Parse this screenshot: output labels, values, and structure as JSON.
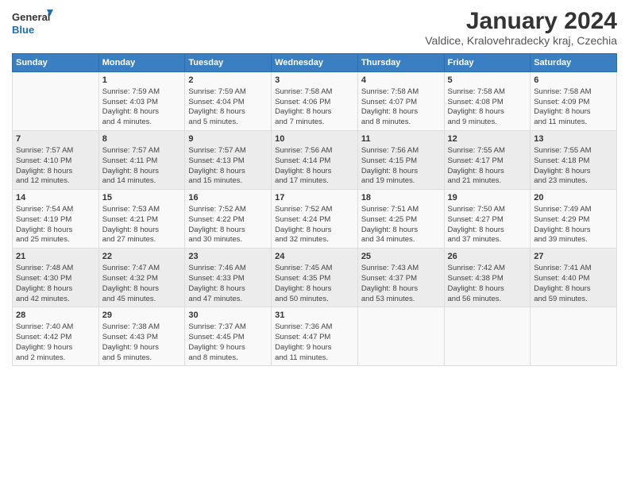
{
  "logo": {
    "line1": "General",
    "line2": "Blue"
  },
  "title": "January 2024",
  "subtitle": "Valdice, Kralovehradecky kraj, Czechia",
  "headers": [
    "Sunday",
    "Monday",
    "Tuesday",
    "Wednesday",
    "Thursday",
    "Friday",
    "Saturday"
  ],
  "weeks": [
    [
      {
        "day": "",
        "info": ""
      },
      {
        "day": "1",
        "info": "Sunrise: 7:59 AM\nSunset: 4:03 PM\nDaylight: 8 hours\nand 4 minutes."
      },
      {
        "day": "2",
        "info": "Sunrise: 7:59 AM\nSunset: 4:04 PM\nDaylight: 8 hours\nand 5 minutes."
      },
      {
        "day": "3",
        "info": "Sunrise: 7:58 AM\nSunset: 4:06 PM\nDaylight: 8 hours\nand 7 minutes."
      },
      {
        "day": "4",
        "info": "Sunrise: 7:58 AM\nSunset: 4:07 PM\nDaylight: 8 hours\nand 8 minutes."
      },
      {
        "day": "5",
        "info": "Sunrise: 7:58 AM\nSunset: 4:08 PM\nDaylight: 8 hours\nand 9 minutes."
      },
      {
        "day": "6",
        "info": "Sunrise: 7:58 AM\nSunset: 4:09 PM\nDaylight: 8 hours\nand 11 minutes."
      }
    ],
    [
      {
        "day": "7",
        "info": "Sunrise: 7:57 AM\nSunset: 4:10 PM\nDaylight: 8 hours\nand 12 minutes."
      },
      {
        "day": "8",
        "info": "Sunrise: 7:57 AM\nSunset: 4:11 PM\nDaylight: 8 hours\nand 14 minutes."
      },
      {
        "day": "9",
        "info": "Sunrise: 7:57 AM\nSunset: 4:13 PM\nDaylight: 8 hours\nand 15 minutes."
      },
      {
        "day": "10",
        "info": "Sunrise: 7:56 AM\nSunset: 4:14 PM\nDaylight: 8 hours\nand 17 minutes."
      },
      {
        "day": "11",
        "info": "Sunrise: 7:56 AM\nSunset: 4:15 PM\nDaylight: 8 hours\nand 19 minutes."
      },
      {
        "day": "12",
        "info": "Sunrise: 7:55 AM\nSunset: 4:17 PM\nDaylight: 8 hours\nand 21 minutes."
      },
      {
        "day": "13",
        "info": "Sunrise: 7:55 AM\nSunset: 4:18 PM\nDaylight: 8 hours\nand 23 minutes."
      }
    ],
    [
      {
        "day": "14",
        "info": "Sunrise: 7:54 AM\nSunset: 4:19 PM\nDaylight: 8 hours\nand 25 minutes."
      },
      {
        "day": "15",
        "info": "Sunrise: 7:53 AM\nSunset: 4:21 PM\nDaylight: 8 hours\nand 27 minutes."
      },
      {
        "day": "16",
        "info": "Sunrise: 7:52 AM\nSunset: 4:22 PM\nDaylight: 8 hours\nand 30 minutes."
      },
      {
        "day": "17",
        "info": "Sunrise: 7:52 AM\nSunset: 4:24 PM\nDaylight: 8 hours\nand 32 minutes."
      },
      {
        "day": "18",
        "info": "Sunrise: 7:51 AM\nSunset: 4:25 PM\nDaylight: 8 hours\nand 34 minutes."
      },
      {
        "day": "19",
        "info": "Sunrise: 7:50 AM\nSunset: 4:27 PM\nDaylight: 8 hours\nand 37 minutes."
      },
      {
        "day": "20",
        "info": "Sunrise: 7:49 AM\nSunset: 4:29 PM\nDaylight: 8 hours\nand 39 minutes."
      }
    ],
    [
      {
        "day": "21",
        "info": "Sunrise: 7:48 AM\nSunset: 4:30 PM\nDaylight: 8 hours\nand 42 minutes."
      },
      {
        "day": "22",
        "info": "Sunrise: 7:47 AM\nSunset: 4:32 PM\nDaylight: 8 hours\nand 45 minutes."
      },
      {
        "day": "23",
        "info": "Sunrise: 7:46 AM\nSunset: 4:33 PM\nDaylight: 8 hours\nand 47 minutes."
      },
      {
        "day": "24",
        "info": "Sunrise: 7:45 AM\nSunset: 4:35 PM\nDaylight: 8 hours\nand 50 minutes."
      },
      {
        "day": "25",
        "info": "Sunrise: 7:43 AM\nSunset: 4:37 PM\nDaylight: 8 hours\nand 53 minutes."
      },
      {
        "day": "26",
        "info": "Sunrise: 7:42 AM\nSunset: 4:38 PM\nDaylight: 8 hours\nand 56 minutes."
      },
      {
        "day": "27",
        "info": "Sunrise: 7:41 AM\nSunset: 4:40 PM\nDaylight: 8 hours\nand 59 minutes."
      }
    ],
    [
      {
        "day": "28",
        "info": "Sunrise: 7:40 AM\nSunset: 4:42 PM\nDaylight: 9 hours\nand 2 minutes."
      },
      {
        "day": "29",
        "info": "Sunrise: 7:38 AM\nSunset: 4:43 PM\nDaylight: 9 hours\nand 5 minutes."
      },
      {
        "day": "30",
        "info": "Sunrise: 7:37 AM\nSunset: 4:45 PM\nDaylight: 9 hours\nand 8 minutes."
      },
      {
        "day": "31",
        "info": "Sunrise: 7:36 AM\nSunset: 4:47 PM\nDaylight: 9 hours\nand 11 minutes."
      },
      {
        "day": "",
        "info": ""
      },
      {
        "day": "",
        "info": ""
      },
      {
        "day": "",
        "info": ""
      }
    ]
  ]
}
